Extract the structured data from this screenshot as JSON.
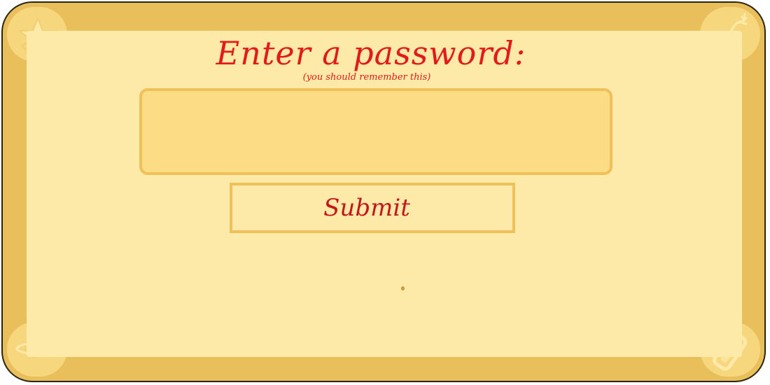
{
  "dialog": {
    "title": "Enter a password:",
    "subtitle": "(you should remember this)",
    "password_value": "",
    "password_placeholder": "",
    "submit_label": "Submit"
  },
  "colors": {
    "frame": "#e9bf5c",
    "panel": "#fde9a8",
    "input_fill": "#fddc86",
    "input_border": "#f0c15b",
    "title_text": "#e21a1a",
    "button_text": "#c4161c"
  },
  "icons": {
    "top_left": "star-icon",
    "top_right": "bomb-icon",
    "bottom_left": "planet-icon",
    "bottom_right": "gem-icon"
  }
}
